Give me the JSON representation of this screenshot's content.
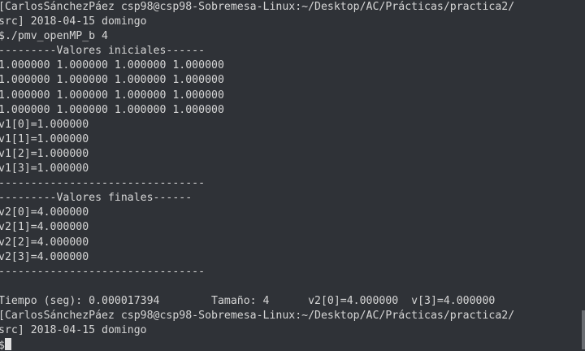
{
  "terminal": {
    "background": "#2f3237",
    "foreground": "#d6d6d6",
    "lines": [
      "[CarlosSánchezPáez csp98@csp98-Sobremesa-Linux:~/Desktop/AC/Prácticas/practica2/",
      "src] 2018-04-15 domingo",
      "$./pmv_openMP_b 4",
      "---------Valores iniciales------",
      "1.000000 1.000000 1.000000 1.000000",
      "1.000000 1.000000 1.000000 1.000000",
      "1.000000 1.000000 1.000000 1.000000",
      "1.000000 1.000000 1.000000 1.000000",
      "v1[0]=1.000000",
      "v1[1]=1.000000",
      "v1[2]=1.000000",
      "v1[3]=1.000000",
      "--------------------------------",
      "---------Valores finales------",
      "v2[0]=4.000000",
      "v2[1]=4.000000",
      "v2[2]=4.000000",
      "v2[3]=4.000000",
      "--------------------------------",
      "",
      "Tiempo (seg): 0.000017394        Tamaño: 4      v2[0]=4.000000  v[3]=4.000000",
      "[CarlosSánchezPáez csp98@csp98-Sobremesa-Linux:~/Desktop/AC/Prácticas/practica2/",
      "src] 2018-04-15 domingo",
      "$"
    ]
  }
}
